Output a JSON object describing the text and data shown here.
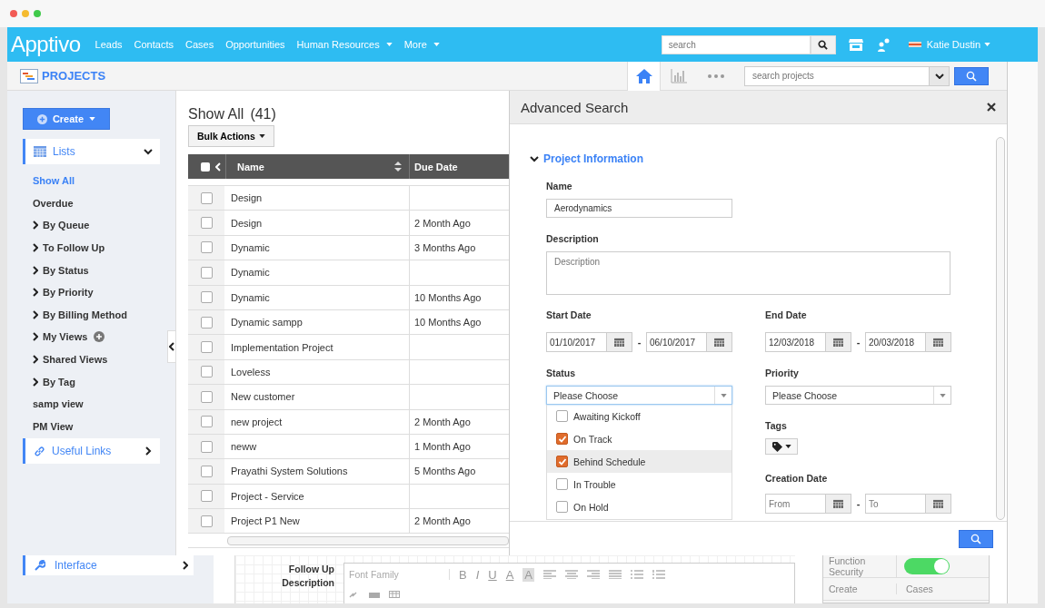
{
  "topbar": {
    "logo": "Apptivo",
    "nav": [
      {
        "label": "Leads",
        "dropdown": false
      },
      {
        "label": "Contacts",
        "dropdown": false
      },
      {
        "label": "Cases",
        "dropdown": false
      },
      {
        "label": "Opportunities",
        "dropdown": false
      },
      {
        "label": "Human Resources",
        "dropdown": true
      },
      {
        "label": "More",
        "dropdown": true
      }
    ],
    "search": {
      "placeholder": "search"
    },
    "user": "Katie Dustin"
  },
  "subbar": {
    "title": "PROJECTS",
    "search": {
      "placeholder": "search projects"
    }
  },
  "sidebar": {
    "create": "Create",
    "lists": {
      "label": "Lists",
      "expanded": true,
      "items": [
        {
          "label": "Show All",
          "kind": "view",
          "selected": true
        },
        {
          "label": "Overdue",
          "kind": "view",
          "selected": false
        },
        {
          "label": "By Queue",
          "kind": "group",
          "selected": false
        },
        {
          "label": "To Follow Up",
          "kind": "group",
          "selected": false
        },
        {
          "label": "By Status",
          "kind": "group",
          "selected": false
        },
        {
          "label": "By Priority",
          "kind": "group",
          "selected": false
        },
        {
          "label": "By Billing Method",
          "kind": "group",
          "selected": false
        },
        {
          "label": "My Views",
          "kind": "group",
          "selected": false,
          "add": true
        },
        {
          "label": "Shared Views",
          "kind": "group",
          "selected": false
        },
        {
          "label": "By Tag",
          "kind": "group",
          "selected": false
        },
        {
          "label": "samp view",
          "kind": "view",
          "selected": false
        },
        {
          "label": "PM View",
          "kind": "view",
          "selected": false
        }
      ]
    },
    "useful_links": {
      "label": "Useful Links",
      "expanded": false
    }
  },
  "list": {
    "title": "Show All",
    "count": "(41)",
    "bulk_actions": "Bulk Actions",
    "select_all": {
      "checked": false
    },
    "columns": [
      "Name",
      "Due Date"
    ],
    "rows": [
      {
        "name": "Design",
        "checked": false
      },
      {
        "name": "Design",
        "due": "2 Month Ago",
        "checked": false
      },
      {
        "name": "Dynamic",
        "due": "3 Months Ago",
        "checked": false
      },
      {
        "name": "Dynamic",
        "checked": false
      },
      {
        "name": "Dynamic",
        "due": "10 Months Ago",
        "checked": false
      },
      {
        "name": "Dynamic sampp",
        "due": "10 Months Ago",
        "checked": false
      },
      {
        "name": "Implementation Project",
        "checked": false
      },
      {
        "name": "Loveless",
        "checked": false
      },
      {
        "name": "New customer",
        "checked": false
      },
      {
        "name": "new project",
        "due": "2 Month Ago",
        "checked": false
      },
      {
        "name": "neww",
        "due": "1 Month Ago",
        "checked": false
      },
      {
        "name": "Prayathi System Solutions",
        "due": "5 Months Ago",
        "checked": false
      },
      {
        "name": "Project - Service",
        "checked": false
      },
      {
        "name": "Project P1 New",
        "due": "2 Month Ago",
        "checked": false
      }
    ]
  },
  "advanced_search": {
    "title": "Advanced Search",
    "section": {
      "title": "Project Information",
      "expanded": true
    },
    "name": {
      "label": "Name",
      "value": "Aerodynamics"
    },
    "description": {
      "label": "Description",
      "placeholder": "Description"
    },
    "start_date": {
      "label": "Start Date",
      "from": "01/10/2017",
      "separator": "-",
      "to": "06/10/2017"
    },
    "end_date": {
      "label": "End Date",
      "from": "12/03/2018",
      "separator": "-",
      "to": "20/03/2018"
    },
    "status": {
      "label": "Status",
      "value": "Please Choose",
      "open": true,
      "options": [
        {
          "label": "Awaiting Kickoff",
          "checked": false,
          "highlighted": false
        },
        {
          "label": "On Track",
          "checked": true,
          "highlighted": false
        },
        {
          "label": "Behind Schedule",
          "checked": true,
          "highlighted": true
        },
        {
          "label": "In Trouble",
          "checked": false,
          "highlighted": false
        },
        {
          "label": "On Hold",
          "checked": false,
          "highlighted": false
        }
      ]
    },
    "priority": {
      "label": "Priority",
      "value": "Please Choose"
    },
    "tags": {
      "label": "Tags"
    },
    "creation_date": {
      "label": "Creation Date",
      "from_placeholder": "From",
      "separator": "-",
      "to_placeholder": "To"
    }
  },
  "background": {
    "sidebar_item": "Interface",
    "editor": {
      "label": "Follow Up Description",
      "font_placeholder": "Font Family",
      "format": [
        "B",
        "I",
        "U",
        "A",
        "A"
      ]
    },
    "settings": [
      {
        "label": "Function Security",
        "kind": "toggle",
        "on": true
      },
      {
        "label": "Create",
        "kind": "text",
        "value": "Cases"
      }
    ]
  }
}
